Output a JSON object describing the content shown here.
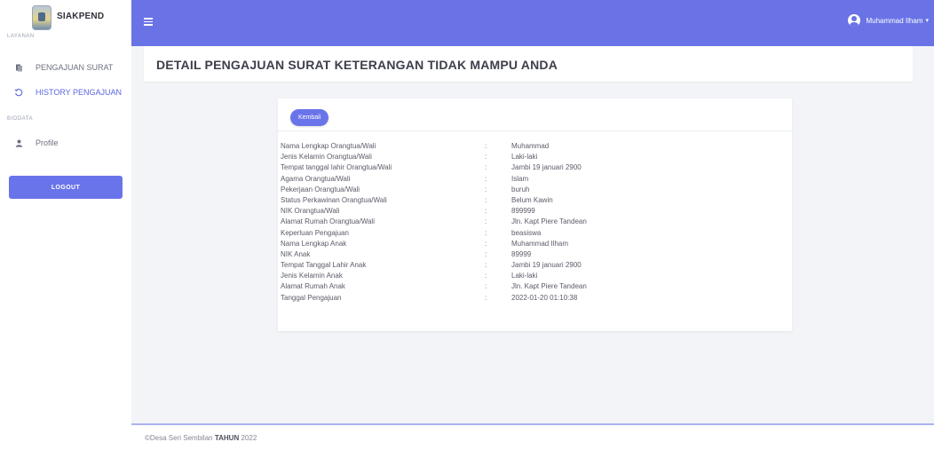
{
  "brand": {
    "name": "SIAKPEND"
  },
  "sidebar": {
    "sections": [
      {
        "label": "LAYANAN"
      },
      {
        "label": "BIODATA"
      }
    ],
    "items": [
      {
        "label": "PENGAJUAN SURAT",
        "icon": "document-icon"
      },
      {
        "label": "HISTORY PENGAJUAN",
        "icon": "history-icon"
      },
      {
        "label": "Profile",
        "icon": "user-icon"
      }
    ],
    "logout_label": "LOGOUT"
  },
  "topbar": {
    "user_name": "Muhammad Ilham",
    "user_caret": "▾"
  },
  "page": {
    "title": "DETAIL PENGAJUAN SURAT KETERANGAN TIDAK MAMPU ANDA"
  },
  "card": {
    "back_label": "Kembali",
    "rows": [
      {
        "label": "Nama Lengkap Orangtua/Wali",
        "value": "Muhammad"
      },
      {
        "label": "Jenis Kelamin Orangtua/Wali",
        "value": "Laki-laki"
      },
      {
        "label": "Tempat tanggal lahir Orangtua/Wali",
        "value": "Jambi 19 januari 2900"
      },
      {
        "label": "Agama Orangtua/Wali",
        "value": "Islam"
      },
      {
        "label": "Pekerjaan Orangtua/Wali",
        "value": "buruh"
      },
      {
        "label": "Status Perkawinan Orangtua/Wali",
        "value": "Belum Kawin"
      },
      {
        "label": "NIK Orangtua/Wali",
        "value": "899999"
      },
      {
        "label": "Alamat Rumah Orangtua/Wali",
        "value": "Jln. Kapt Piere Tandean"
      },
      {
        "label": "Keperluan Pengajuan",
        "value": "beasiswa"
      },
      {
        "label": "Nama Lengkap Anak",
        "value": "Muhammad Ilham"
      },
      {
        "label": "NIK Anak",
        "value": "89999"
      },
      {
        "label": "Tempat Tanggal Lahir Anak",
        "value": "Jambi 19 januari 2900"
      },
      {
        "label": "Jenis Kelamin Anak",
        "value": "Laki-laki"
      },
      {
        "label": "Alamat Rumah Anak",
        "value": "Jln. Kapt Piere Tandean"
      },
      {
        "label": "Tanggal Pengajuan",
        "value": "2022-01-20 01:10:38"
      }
    ],
    "separator": ":"
  },
  "footer": {
    "prefix": "©Desa Seri Sembilan",
    "bold": "TAHUN",
    "year": "2022"
  },
  "colors": {
    "accent": "#6973e6",
    "button": "#6a74ea",
    "active_nav": "#5b67e0",
    "background": "#f3f4f8"
  }
}
